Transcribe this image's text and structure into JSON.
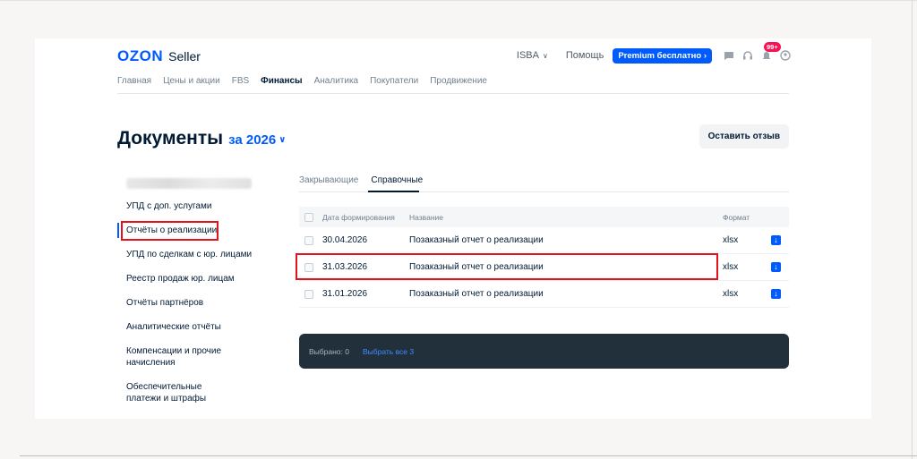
{
  "header": {
    "logo_brand": "OZON",
    "logo_product": "Seller",
    "company": "ISBA",
    "help": "Помощь",
    "premium": "Premium бесплатно",
    "notifications_badge": "99+",
    "icons": [
      "chat-icon",
      "headset-icon",
      "bell-icon",
      "profile-icon"
    ]
  },
  "nav": {
    "items": [
      "Главная",
      "Цены и акции",
      "FBS",
      "Финансы",
      "Аналитика",
      "Покупатели",
      "Продвижение"
    ],
    "active": "Финансы"
  },
  "page": {
    "title": "Документы",
    "year_selector": "за 2026",
    "review_button": "Оставить отзыв"
  },
  "sidebar": {
    "items": [
      "УПД с доп. услугами",
      "Отчёты о реализации",
      "УПД по сделкам с юр. лицами",
      "Реестр продаж юр. лицам",
      "Отчёты партнёров",
      "Аналитические отчёты",
      "Компенсации и прочие начисления",
      "Обеспечительные платежи и штрафы"
    ],
    "active_index": 1
  },
  "tabs": [
    "Закрывающие",
    "Справочные"
  ],
  "table": {
    "headers": {
      "date": "Дата формирования",
      "name": "Название",
      "format": "Формат"
    },
    "rows": [
      {
        "date": "30.04.2026",
        "name": "Позаказный отчет о реализации",
        "format": "xlsx"
      },
      {
        "date": "31.03.2026",
        "name": "Позаказный отчет о реализации",
        "format": "xlsx"
      },
      {
        "date": "31.01.2026",
        "name": "Позаказный отчет о реализации",
        "format": "xlsx"
      }
    ]
  },
  "selection": {
    "selected": "Выбрано: 0",
    "select_all": "Выбрать все 3"
  },
  "colors": {
    "accent": "#005bff",
    "highlight": "#e3131b",
    "dark_bar": "#22303c"
  }
}
